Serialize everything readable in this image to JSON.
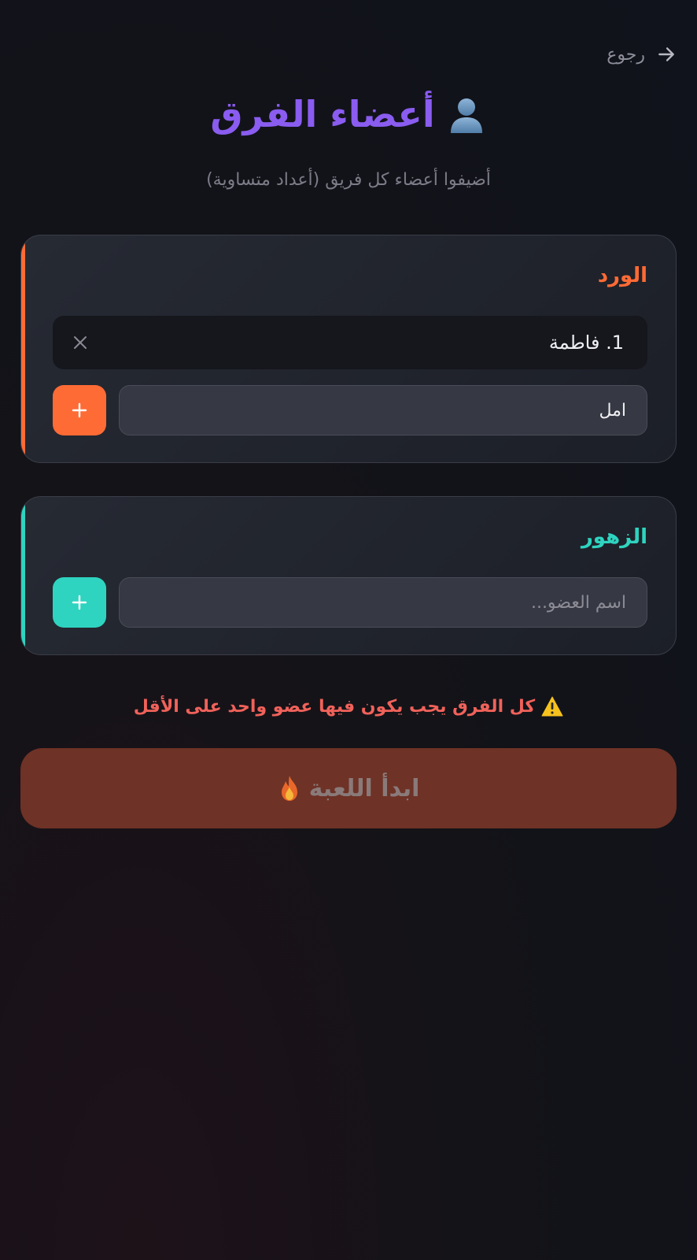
{
  "nav": {
    "back_label": "رجوع"
  },
  "header": {
    "title": "أعضاء الفرق",
    "subtitle": "أضيفوا أعضاء كل فريق (أعداد متساوية)"
  },
  "teams": [
    {
      "name": "الورد",
      "accent_color": "#ff6b35",
      "members": [
        "1. فاطمة"
      ],
      "input_value": "امل",
      "input_placeholder": "اسم العضو..."
    },
    {
      "name": "الزهور",
      "accent_color": "#2ed4c0",
      "members": [],
      "input_value": "",
      "input_placeholder": "اسم العضو..."
    }
  ],
  "warning": {
    "text": "كل الفرق يجب يكون فيها عضو واحد على الأقل",
    "color": "#f0625a"
  },
  "start_button": {
    "label": "ابدأ اللعبة"
  },
  "icons": {
    "back": "arrow-right-icon",
    "title": "person-icon",
    "remove": "close-icon",
    "add": "plus-icon",
    "warning": "warning-icon",
    "start": "fire-icon"
  },
  "colors": {
    "title": "#8a5cf0",
    "background": "#131318"
  }
}
